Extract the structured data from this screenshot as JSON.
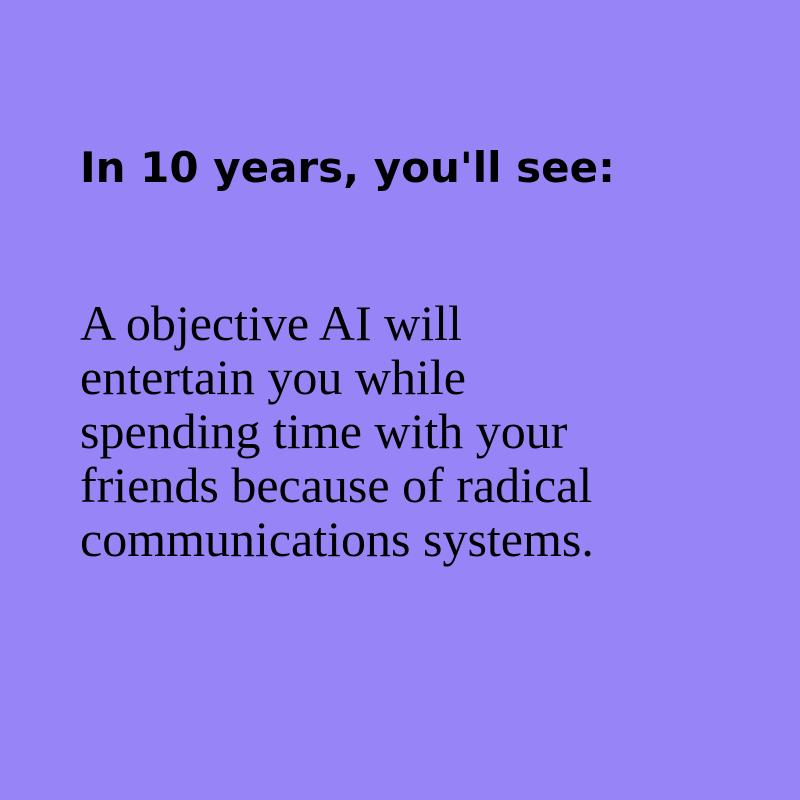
{
  "colors": {
    "background": "#9785f7",
    "text": "#000000"
  },
  "heading": "In 10 years, you'll see:",
  "body_lines": [
    "A objective AI will",
    "entertain you while",
    "spending time with your",
    "friends because of radical",
    "communications systems."
  ]
}
